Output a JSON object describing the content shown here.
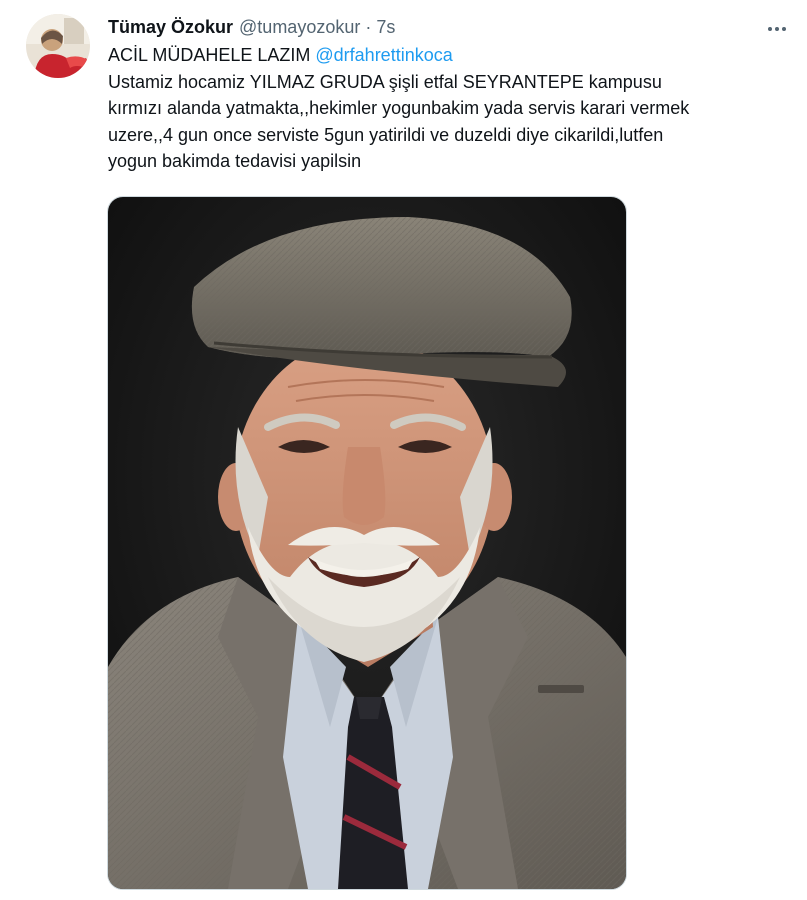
{
  "tweet": {
    "author": {
      "display_name": "Tümay Özokur",
      "handle": "@tumayozokur",
      "separator": "·",
      "time": "7s"
    },
    "text": {
      "line1_prefix": "ACİL MÜDAHELE LAZIM ",
      "mention": "@drfahrettinkoca",
      "line2": "Ustamiz hocamiz YILMAZ GRUDA şişli etfal SEYRANTEPE kampusu",
      "line3": "kırmızı alanda yatmakta,,hekimler yogunbakim yada servis karari vermek",
      "line4": "uzere,,4 gun once serviste 5gun yatirildi ve duzeldi diye cikarildi,lutfen",
      "line5": "yogun bakimda tedavisi yapilsin"
    },
    "more_icon": "more-horizontal-icon",
    "media": {
      "type": "photo",
      "description_icon": "portrait-photo"
    }
  },
  "colors": {
    "text_primary": "#0f1419",
    "text_secondary": "#536471",
    "link": "#1d9bf0",
    "border": "#cfd9de"
  }
}
